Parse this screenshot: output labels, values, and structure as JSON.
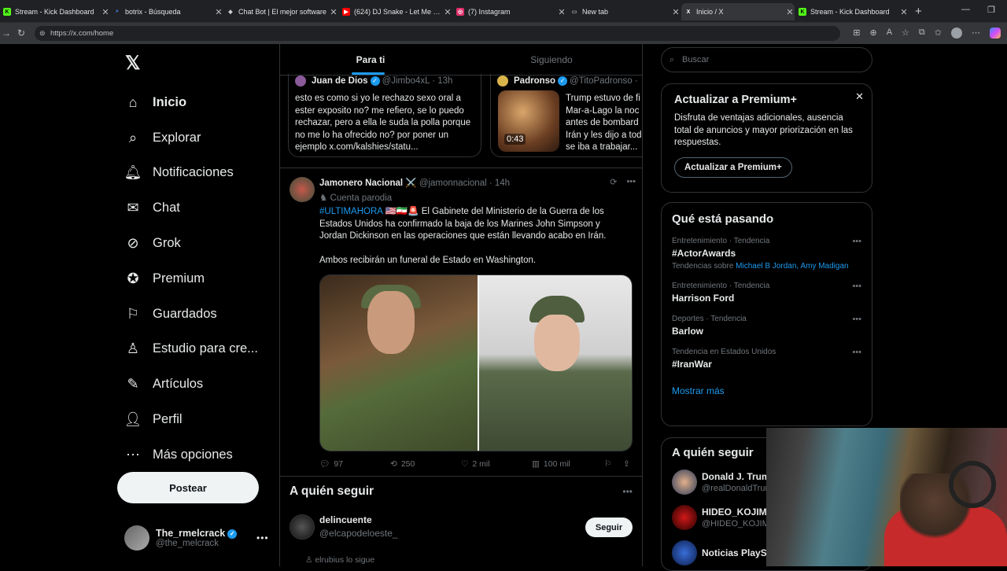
{
  "browser": {
    "tabs": [
      {
        "title": "Stream - Kick Dashboard",
        "color": "#53fc18",
        "glyph": "K"
      },
      {
        "title": "botrix - Búsqueda",
        "color": "#4285f4",
        "glyph": "⌕"
      },
      {
        "title": "Chat Bot | El mejor software",
        "color": "#cccccc",
        "glyph": "◆"
      },
      {
        "title": "(624) DJ Snake - Let Me Love",
        "color": "#ff0000",
        "glyph": "▶"
      },
      {
        "title": "(7) Instagram",
        "color": "#e1306c",
        "glyph": "◎"
      },
      {
        "title": "New tab",
        "color": "#aaaaaa",
        "glyph": "▭"
      },
      {
        "title": "Inicio / X",
        "color": "#ffffff",
        "glyph": "X"
      },
      {
        "title": "Stream - Kick Dashboard",
        "color": "#53fc18",
        "glyph": "K"
      }
    ],
    "url": "https://x.com/home"
  },
  "nav": {
    "logo": "𝕏",
    "items": [
      {
        "label": "Inicio",
        "icon": "home-icon",
        "glyph": "⌂"
      },
      {
        "label": "Explorar",
        "icon": "search-icon",
        "glyph": "⌕"
      },
      {
        "label": "Notificaciones",
        "icon": "bell-icon",
        "glyph": "🔔︎"
      },
      {
        "label": "Chat",
        "icon": "mail-icon",
        "glyph": "✉"
      },
      {
        "label": "Grok",
        "icon": "grok-icon",
        "glyph": "⊘"
      },
      {
        "label": "Premium",
        "icon": "premium-icon",
        "glyph": "✪"
      },
      {
        "label": "Guardados",
        "icon": "bookmark-icon",
        "glyph": "⚐"
      },
      {
        "label": "Estudio para cre...",
        "icon": "studio-icon",
        "glyph": "♙"
      },
      {
        "label": "Artículos",
        "icon": "articles-icon",
        "glyph": "✎"
      },
      {
        "label": "Perfil",
        "icon": "profile-icon",
        "glyph": "👤︎"
      },
      {
        "label": "Más opciones",
        "icon": "more-icon",
        "glyph": "⋯"
      }
    ],
    "post_label": "Postear",
    "user": {
      "name": "The_rmelcrack",
      "handle": "@the_melcrack"
    }
  },
  "feed": {
    "tabs": [
      "Para ti",
      "Siguiendo"
    ],
    "card1": {
      "name": "Juan de Dios",
      "handle": "@Jimbo4xL · 13h",
      "text": "esto es como si yo le rechazo sexo oral a ester exposito no? me refiero, se lo puedo rechazar, pero a ella le suda la polla porque no me lo ha ofrecido no? por poner un ejemplo x.com/kalshies/statu..."
    },
    "card2": {
      "name": "Padronso",
      "handle": "@TitoPadronso ·",
      "text": "Trump estuvo de fi Mar-a-Lago la noc antes de bombard Irán y les dijo a tod se iba a trabajar...",
      "duration": "0:43"
    },
    "tweet": {
      "name": "Jamonero Nacional ⚔️",
      "handle": "@jamonnacional · 14h",
      "parody": "Cuenta parodia",
      "hashtag": "#ULTIMAHORA",
      "flags": "🇺🇸🇮🇷🚨",
      "text1": "El Gabinete del Ministerio de la Guerra de los Estados Unidos ha confirmado la baja de los Marines John Simpson y Jordan Dickinson en las operaciones que están llevando acabo en Irán.",
      "text2": "Ambos recibirán un funeral de Estado en Washington.",
      "replies": "97",
      "reposts": "250",
      "likes": "2 mil",
      "views": "100 mil"
    },
    "follow": {
      "heading": "A quién seguir",
      "name": "delincuente",
      "handle": "@elcapodeloeste_",
      "button": "Seguir",
      "followed_by": "elrubius lo sigue"
    }
  },
  "sidebar": {
    "search_placeholder": "Buscar",
    "premium": {
      "title": "Actualizar a Premium+",
      "text": "Disfruta de ventajas adicionales, ausencia total de anuncios y mayor priorización en las respuestas.",
      "button": "Actualizar a Premium+"
    },
    "trends": {
      "heading": "Qué está pasando",
      "items": [
        {
          "category": "Entretenimiento · Tendencia",
          "name": "#ActorAwards",
          "sub": "Tendencias sobre",
          "links": "Michael B Jordan, Amy Madigan"
        },
        {
          "category": "Entretenimiento · Tendencia",
          "name": "Harrison Ford"
        },
        {
          "category": "Deportes · Tendencia",
          "name": "Barlow"
        },
        {
          "category": "Tendencia en Estados Unidos",
          "name": "#IranWar"
        }
      ],
      "show_more": "Mostrar más"
    },
    "who_to_follow": {
      "heading": "A quién seguir",
      "items": [
        {
          "name": "Donald J. Trump",
          "handle": "@realDonaldTrump"
        },
        {
          "name": "HIDEO_KOJIMA",
          "handle": "@HIDEO_KOJIMA"
        },
        {
          "name": "Noticias PlayStation",
          "handle": ""
        }
      ]
    }
  }
}
